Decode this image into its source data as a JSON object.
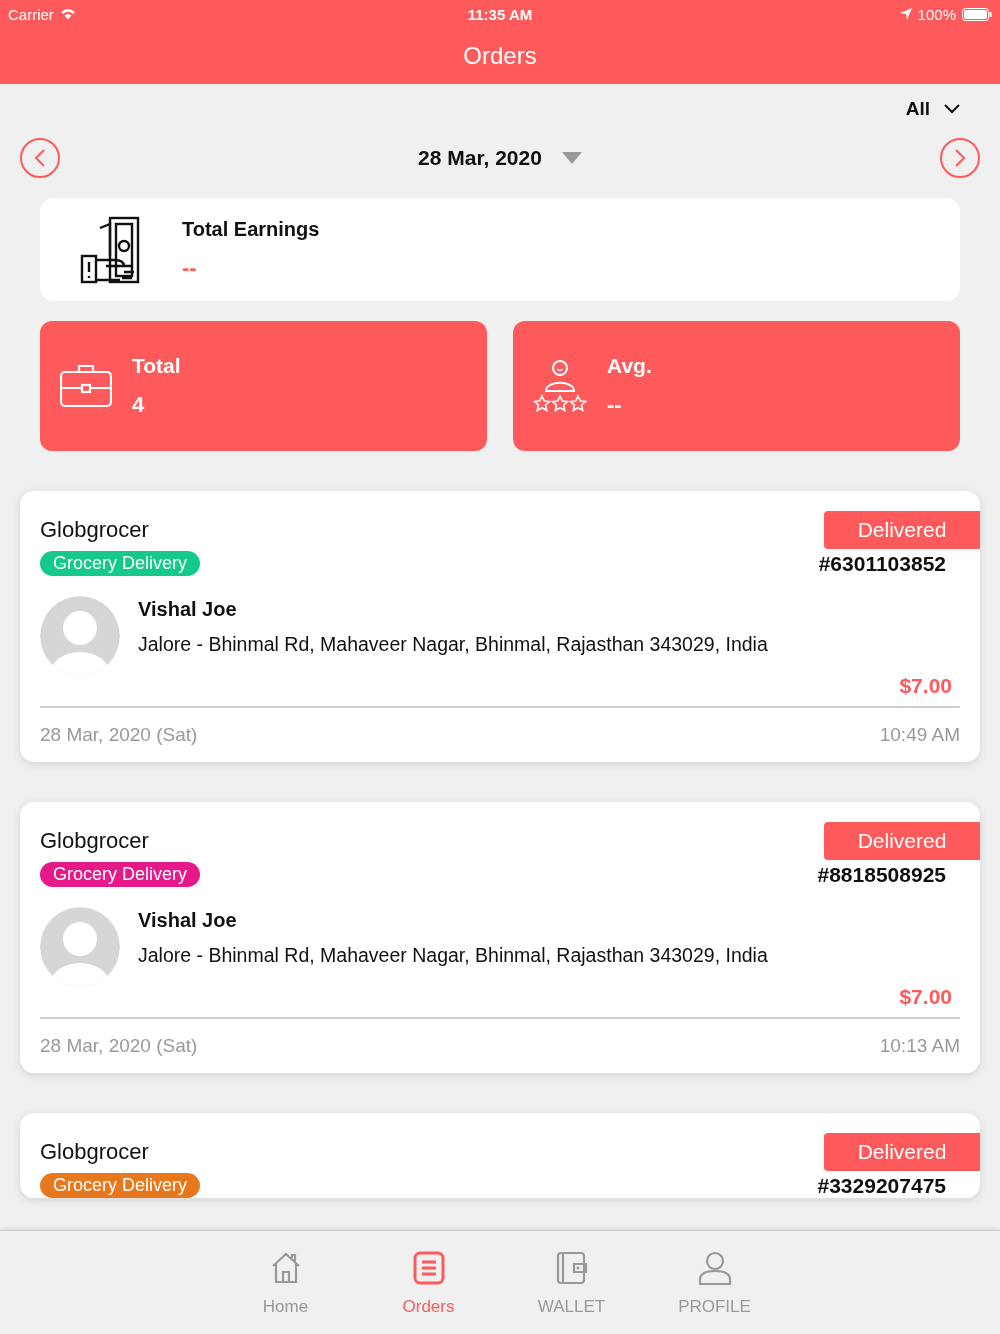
{
  "status_bar": {
    "carrier": "Carrier",
    "time": "11:35 AM",
    "battery": "100%"
  },
  "header": {
    "title": "Orders"
  },
  "filter": {
    "value": "All"
  },
  "date_nav": {
    "date": "28 Mar, 2020"
  },
  "earnings": {
    "label": "Total Earnings",
    "value": "--"
  },
  "stats": [
    {
      "kind": "total",
      "label": "Total",
      "value": "4"
    },
    {
      "kind": "rating",
      "label": "Avg.",
      "value": "--"
    }
  ],
  "orders": [
    {
      "store": "Globgrocer",
      "status": "Delivered",
      "tag": {
        "label": "Grocery Delivery",
        "color": "#14c98a"
      },
      "number": "#6301103852",
      "customer": "Vishal Joe",
      "address": "Jalore - Bhinmal Rd, Mahaveer Nagar, Bhinmal, Rajasthan 343029, India",
      "price": "$7.00",
      "date": "28 Mar, 2020 (Sat)",
      "time": "10:49 AM"
    },
    {
      "store": "Globgrocer",
      "status": "Delivered",
      "tag": {
        "label": "Grocery Delivery",
        "color": "#e6198a"
      },
      "number": "#8818508925",
      "customer": "Vishal Joe",
      "address": "Jalore - Bhinmal Rd, Mahaveer Nagar, Bhinmal, Rajasthan 343029, India",
      "price": "$7.00",
      "date": "28 Mar, 2020 (Sat)",
      "time": "10:13 AM"
    },
    {
      "store": "Globgrocer",
      "status": "Delivered",
      "tag": {
        "label": "Grocery Delivery",
        "color": "#e8781e"
      },
      "number": "#3329207475"
    }
  ],
  "tab_bar": [
    {
      "kind": "home",
      "label": "Home",
      "selected": false
    },
    {
      "kind": "orders",
      "label": "Orders",
      "selected": true
    },
    {
      "kind": "wallet",
      "label": "WALLET",
      "selected": false
    },
    {
      "kind": "profile",
      "label": "PROFILE",
      "selected": false
    }
  ]
}
